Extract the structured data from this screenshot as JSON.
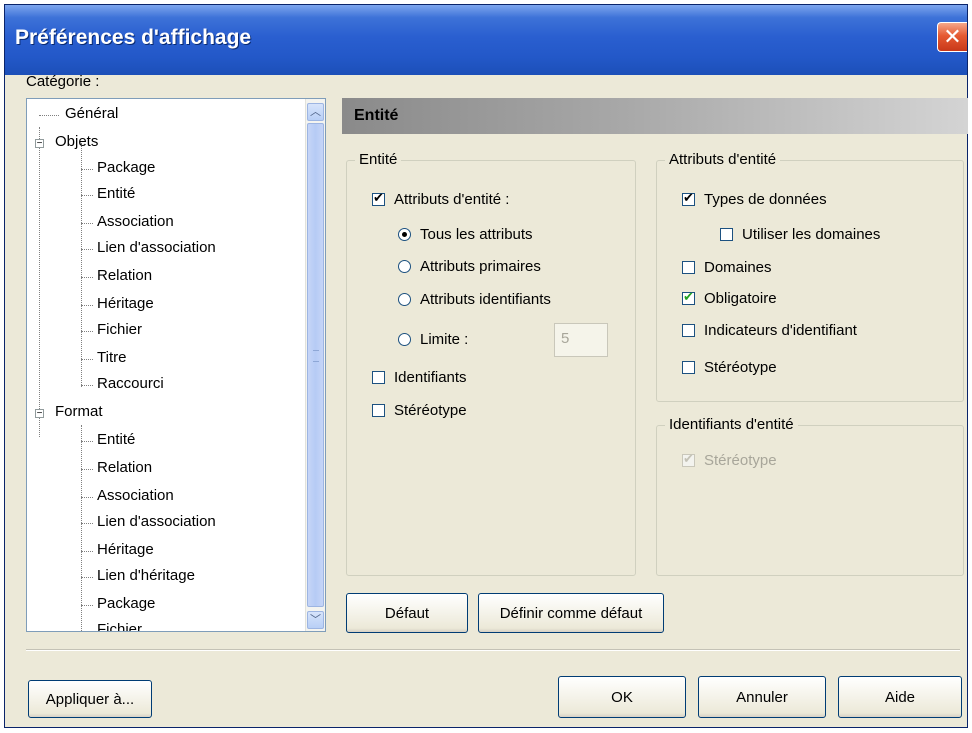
{
  "window": {
    "title": "Préférences d'affichage",
    "close_glyph": "✕"
  },
  "category_label": "Catégorie :",
  "tree": {
    "items": [
      {
        "label": "Général"
      },
      {
        "label": "Objets"
      },
      {
        "label": "Package"
      },
      {
        "label": "Entité"
      },
      {
        "label": "Association"
      },
      {
        "label": "Lien d'association"
      },
      {
        "label": "Relation"
      },
      {
        "label": "Héritage"
      },
      {
        "label": "Fichier"
      },
      {
        "label": "Titre"
      },
      {
        "label": "Raccourci"
      },
      {
        "label": "Format"
      },
      {
        "label": "Entité"
      },
      {
        "label": "Relation"
      },
      {
        "label": "Association"
      },
      {
        "label": "Lien d'association"
      },
      {
        "label": "Héritage"
      },
      {
        "label": "Lien d'héritage"
      },
      {
        "label": "Package"
      },
      {
        "label": "Fichier"
      }
    ],
    "collapse_glyph": "−",
    "scroll_up_glyph": "︿",
    "scroll_down_glyph": "﹀"
  },
  "section_header": "Entité",
  "entity_group": {
    "title": "Entité",
    "attributes_label": "Attributs d'entité :",
    "attributes_checked": true,
    "radio_all": "Tous les attributs",
    "radio_primary": "Attributs primaires",
    "radio_identifying": "Attributs identifiants",
    "radio_limit": "Limite :",
    "selected_radio": "all",
    "limit_value": "5",
    "identifiers_label": "Identifiants",
    "identifiers_checked": false,
    "stereotype_label": "Stéréotype",
    "stereotype_checked": false
  },
  "entity_attributes_group": {
    "title": "Attributs d'entité",
    "data_types": "Types de données",
    "data_types_checked": true,
    "use_domains": "Utiliser les domaines",
    "use_domains_checked": false,
    "domains": "Domaines",
    "domains_checked": false,
    "mandatory": "Obligatoire",
    "mandatory_checked": true,
    "identifier_indicators": "Indicateurs d'identifiant",
    "identifier_indicators_checked": false,
    "stereotype": "Stéréotype",
    "stereotype_checked": false
  },
  "entity_identifiers_group": {
    "title": "Identifiants d'entité",
    "stereotype": "Stéréotype",
    "stereotype_checked": true,
    "stereotype_enabled": false
  },
  "buttons": {
    "default": "Défaut",
    "set_default": "Définir comme défaut",
    "apply_to": "Appliquer à...",
    "ok": "OK",
    "cancel": "Annuler",
    "help": "Aide"
  }
}
